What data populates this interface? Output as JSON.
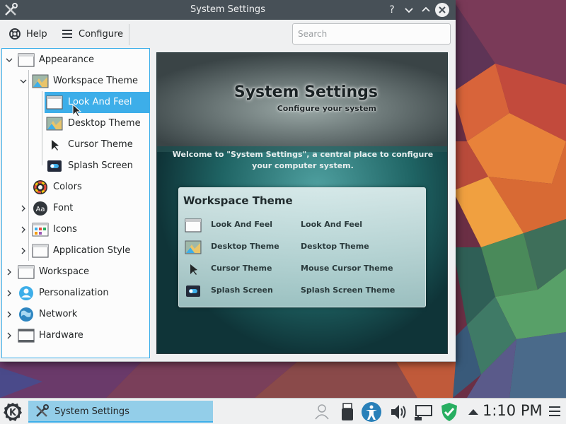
{
  "window": {
    "title": "System Settings",
    "buttons": {
      "help": "?",
      "minimize": "⌄",
      "maximize": "⌃",
      "close": "✕"
    }
  },
  "toolbar": {
    "help_label": "Help",
    "configure_label": "Configure",
    "search_placeholder": "Search",
    "search_value": ""
  },
  "tree": {
    "items": [
      {
        "label": "Appearance",
        "icon": "appearance-icon",
        "expanded": true
      },
      {
        "label": "Workspace Theme",
        "icon": "workspace-theme-icon",
        "expanded": true
      },
      {
        "label": "Look And Feel",
        "icon": "look-and-feel-icon",
        "selected": true
      },
      {
        "label": "Desktop Theme",
        "icon": "desktop-theme-icon"
      },
      {
        "label": "Cursor Theme",
        "icon": "cursor-theme-icon"
      },
      {
        "label": "Splash Screen",
        "icon": "splash-screen-icon"
      },
      {
        "label": "Colors",
        "icon": "colors-icon"
      },
      {
        "label": "Font",
        "icon": "font-icon"
      },
      {
        "label": "Icons",
        "icon": "icons-icon"
      },
      {
        "label": "Application Style",
        "icon": "application-style-icon"
      },
      {
        "label": "Workspace",
        "icon": "workspace-icon"
      },
      {
        "label": "Personalization",
        "icon": "personalization-icon"
      },
      {
        "label": "Network",
        "icon": "network-icon"
      },
      {
        "label": "Hardware",
        "icon": "hardware-icon"
      }
    ]
  },
  "content": {
    "title": "System Settings",
    "subtitle": "Configure your system",
    "welcome": "Welcome to \"System Settings\", a central place to configure your computer system.",
    "card": {
      "title": "Workspace Theme",
      "rows": [
        {
          "name": "Look And Feel",
          "description": "Look And Feel",
          "icon": "look-and-feel-icon"
        },
        {
          "name": "Desktop Theme",
          "description": "Desktop Theme",
          "icon": "desktop-theme-icon"
        },
        {
          "name": "Cursor Theme",
          "description": "Mouse Cursor Theme",
          "icon": "cursor-theme-icon"
        },
        {
          "name": "Splash Screen",
          "description": "Splash Screen Theme",
          "icon": "splash-screen-icon"
        }
      ]
    }
  },
  "taskbar": {
    "task_label": "System Settings",
    "clock": "1:10 PM",
    "tray_icons": [
      "user-switcher-icon",
      "usb-drive-icon",
      "accessibility-icon",
      "volume-icon",
      "network-wired-icon",
      "security-shield-icon",
      "tray-expand-icon"
    ]
  },
  "colors": {
    "accent": "#3daee9",
    "titlebar": "#475057",
    "window_bg": "#eff0f1",
    "task_highlight": "#93cee9"
  }
}
